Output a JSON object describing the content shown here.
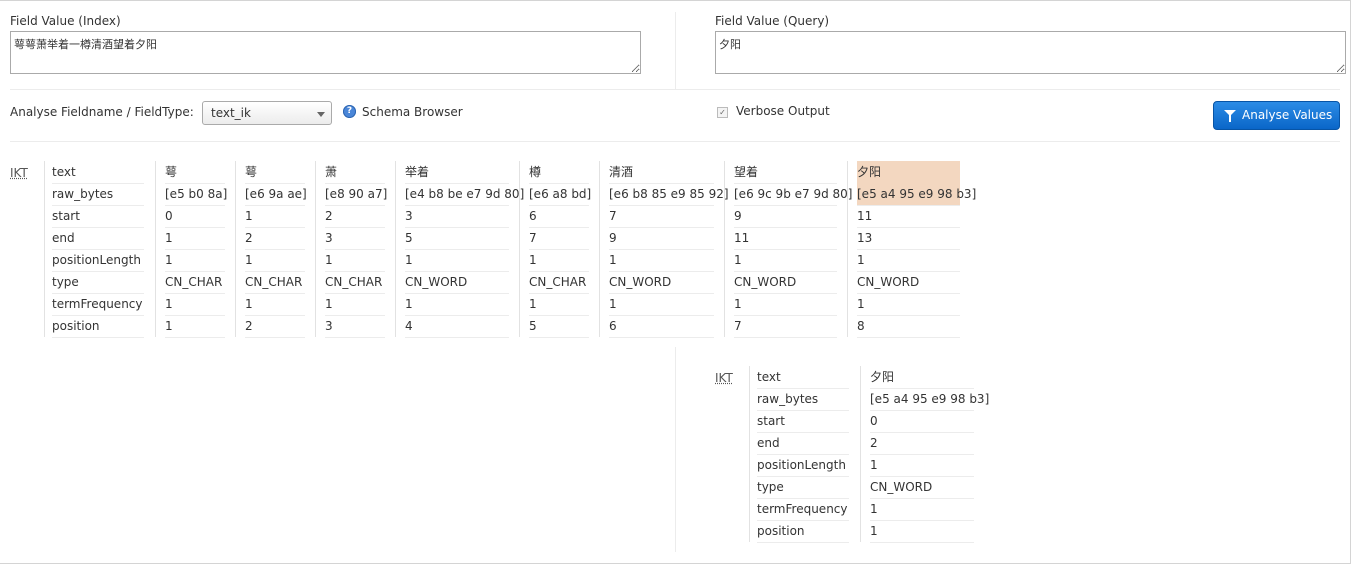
{
  "index": {
    "label": "Field Value (Index)",
    "value": "萼萼萧举着一樽清酒望着夕阳"
  },
  "query": {
    "label": "Field Value (Query)",
    "value": "夕阳"
  },
  "analyse": {
    "label": "Analyse Fieldname / FieldType:",
    "selected": "text_ik"
  },
  "schema_browser": "Schema Browser",
  "verbose": {
    "label": "Verbose Output",
    "checked": true
  },
  "analyse_button": "Analyse Values",
  "row_labels": [
    "text",
    "raw_bytes",
    "start",
    "end",
    "positionLength",
    "type",
    "termFrequency",
    "position"
  ],
  "index_result": {
    "analyzer": "IKT",
    "tokens": [
      [
        "萼",
        "[e5 b0 8a]",
        "0",
        "1",
        "1",
        "CN_CHAR",
        "1",
        "1"
      ],
      [
        "萼",
        "[e6 9a ae]",
        "1",
        "2",
        "1",
        "CN_CHAR",
        "1",
        "2"
      ],
      [
        "萧",
        "[e8 90 a7]",
        "2",
        "3",
        "1",
        "CN_CHAR",
        "1",
        "3"
      ],
      [
        "举着",
        "[e4 b8 be e7 9d 80]",
        "3",
        "5",
        "1",
        "CN_WORD",
        "1",
        "4"
      ],
      [
        "樽",
        "[e6 a8 bd]",
        "6",
        "7",
        "1",
        "CN_CHAR",
        "1",
        "5"
      ],
      [
        "清酒",
        "[e6 b8 85 e9 85 92]",
        "7",
        "9",
        "1",
        "CN_WORD",
        "1",
        "6"
      ],
      [
        "望着",
        "[e6 9c 9b e7 9d 80]",
        "9",
        "11",
        "1",
        "CN_WORD",
        "1",
        "7"
      ],
      [
        "夕阳",
        "[e5 a4 95 e9 98 b3]",
        "11",
        "13",
        "1",
        "CN_WORD",
        "1",
        "8"
      ]
    ]
  },
  "query_result": {
    "analyzer": "IKT",
    "tokens": [
      [
        "夕阳",
        "[e5 a4 95 e9 98 b3]",
        "0",
        "2",
        "1",
        "CN_WORD",
        "1",
        "1"
      ]
    ]
  }
}
